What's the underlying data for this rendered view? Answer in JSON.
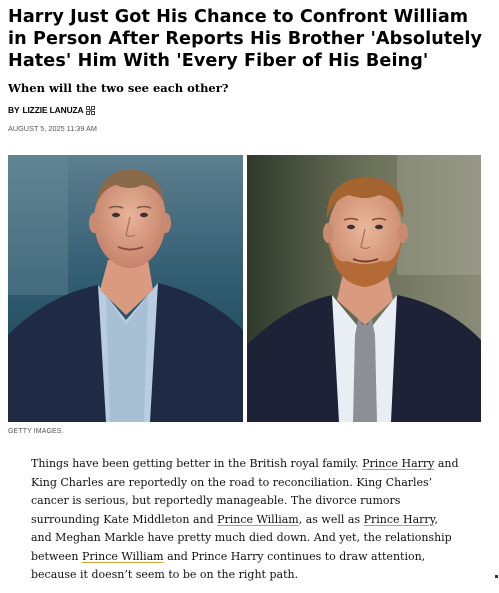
{
  "article": {
    "headline": "Harry Just Got His Chance to Confront William in Person After Reports His Brother 'Absolutely Hates' Him With 'Every Fiber of His Being'",
    "dek": "When will the two see each other?",
    "byline_prefix": "BY",
    "author": "LIZZIE LANUZA",
    "date": "AUGUST 5, 2025 11:39 AM",
    "image_credit": "GETTY IMAGES."
  },
  "body": {
    "t1": "Things have been getting better in the British royal family. ",
    "link_harry_1": "Prince Harry",
    "t2": " and King Charles are reportedly on the road to reconciliation. King Charles’ cancer is serious, but reportedly manageable. The divorce rumors surrounding Kate Middleton and ",
    "link_william_1": "Prince William",
    "t3": ", as well as ",
    "link_harry_2": "Prince Harry",
    "t4": ", and Meghan Markle have pretty much died down. And yet, the relationship between ",
    "link_william_2": "Prince William",
    "t5": " and Prince Harry continues to draw attention, because it doesn’t seem to be on the right path."
  },
  "colors": {
    "link_underline": "#c9a23c",
    "text": "#111111",
    "meta": "#555555"
  },
  "icons": {
    "byline_icon": "share-icon"
  }
}
